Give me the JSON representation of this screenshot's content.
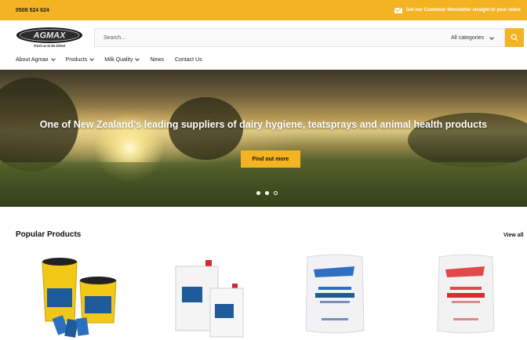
{
  "topbar": {
    "phone": "0508 524 624",
    "newsletter_text": "Get our Customer Newsletter straight to your inbox",
    "bg_color": "#f4b322"
  },
  "header": {
    "logo_text": "AGMAX",
    "logo_tagline": "Trust us to be Direct",
    "search_placeholder": "Search...",
    "category_select": "All categories",
    "search_icon": "search-icon"
  },
  "nav": {
    "items": [
      {
        "label": "About Agmax",
        "has_dropdown": true
      },
      {
        "label": "Products",
        "has_dropdown": true
      },
      {
        "label": "Milk Quality",
        "has_dropdown": true
      },
      {
        "label": "News",
        "has_dropdown": false
      },
      {
        "label": "Contact Us",
        "has_dropdown": false
      }
    ]
  },
  "hero": {
    "headline": "One of New Zealand's leading suppliers of dairy hygiene, teatsprays and animal health products",
    "cta_label": "Find out more",
    "slides_total": 3,
    "slide_active": 2
  },
  "popular": {
    "title": "Popular Products",
    "view_all": "View all"
  },
  "products": [
    {
      "icon": "yellow-buckets-product-image"
    },
    {
      "icon": "white-jerry-cans-product-image"
    },
    {
      "icon": "blue-label-sack-product-image"
    },
    {
      "icon": "red-label-sack-product-image"
    }
  ]
}
